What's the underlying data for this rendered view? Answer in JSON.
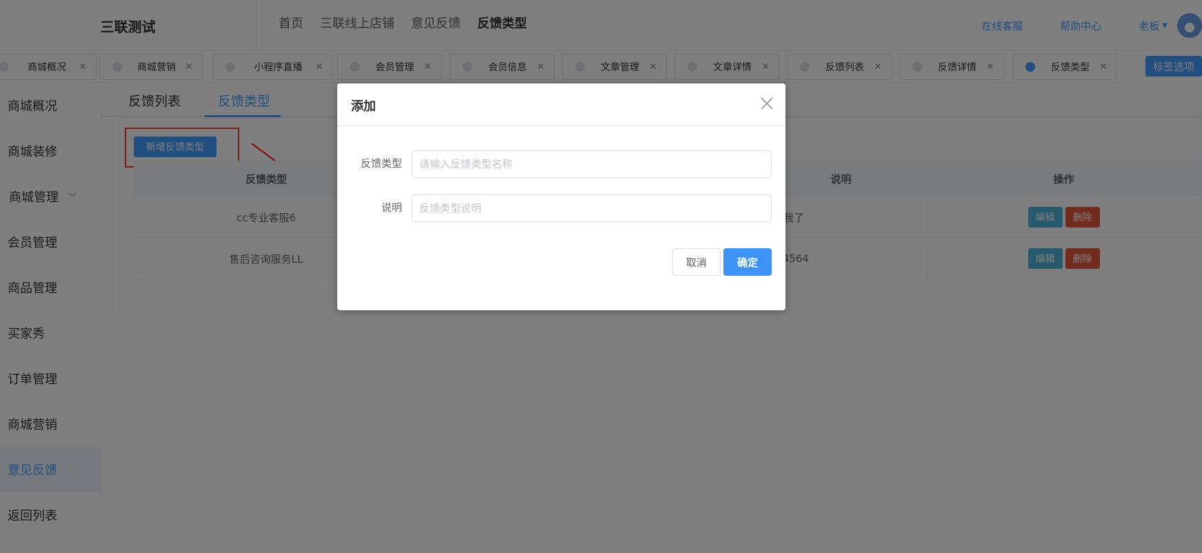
{
  "header": {
    "brand": "三联测试",
    "nav": [
      "首页",
      "三联线上店铺",
      "意见反馈",
      "反馈类型"
    ],
    "online_service": "在线客服",
    "help_center": "帮助中心",
    "user_name": "老板"
  },
  "tabs": {
    "items": [
      {
        "label": "商城概况"
      },
      {
        "label": "商城营销"
      },
      {
        "label": "小程序直播"
      },
      {
        "label": "会员管理"
      },
      {
        "label": "会员信息"
      },
      {
        "label": "文章管理"
      },
      {
        "label": "文章详情"
      },
      {
        "label": "反馈列表"
      },
      {
        "label": "反馈详情"
      },
      {
        "label": "反馈类型"
      }
    ],
    "active_index": 9,
    "options_label": "标签选项"
  },
  "sidebar": {
    "items": [
      {
        "label": "商城概况"
      },
      {
        "label": "商城装修"
      },
      {
        "label": "商城管理"
      },
      {
        "label": "会员管理"
      },
      {
        "label": "商品管理"
      },
      {
        "label": "买家秀"
      },
      {
        "label": "订单管理"
      },
      {
        "label": "商城营销"
      },
      {
        "label": "意见反馈"
      },
      {
        "label": "返回列表"
      }
    ],
    "active_index": 8
  },
  "main": {
    "subtabs": [
      "反馈列表",
      "反馈类型"
    ],
    "add_button": "新增反馈类型",
    "table": {
      "headers": [
        "反馈类型",
        "说明",
        "操作"
      ],
      "rows": [
        {
          "type": "cc专业客服6",
          "desc": "投诉我了"
        },
        {
          "type": "售后咨询服务LL",
          "desc": "4564564"
        }
      ],
      "edit_label": "编辑",
      "delete_label": "删除"
    }
  },
  "dialog": {
    "title": "添加",
    "type_label": "反馈类型",
    "type_placeholder": "请输入反馈类型名称",
    "desc_label": "说明",
    "desc_placeholder": "反馈类型说明",
    "cancel": "取消",
    "confirm": "确定"
  },
  "colors": {
    "primary": "#409eff",
    "danger": "#e5583f",
    "info": "#49b5d9",
    "annotation": "#ff3b3b"
  }
}
